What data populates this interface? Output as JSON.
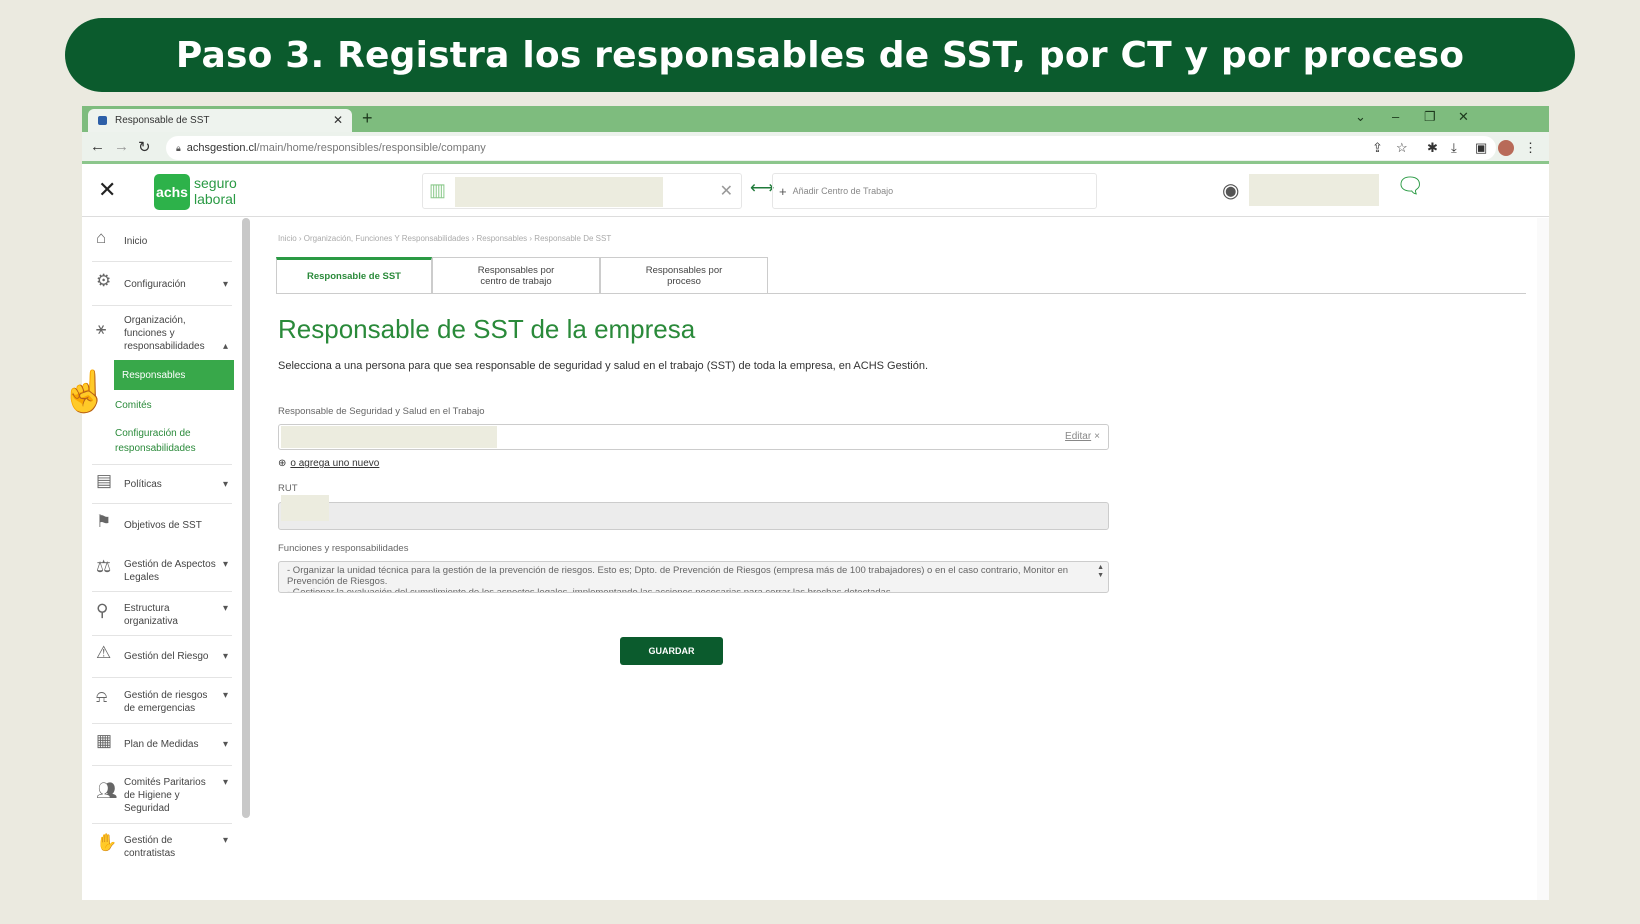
{
  "banner": {
    "title": "Paso 3. Registra los responsables de SST, por CT y por proceso"
  },
  "browser": {
    "tab_title": "Responsable de SST",
    "new_tab": "+",
    "url_host": "achsgestion.cl",
    "url_path": "/main/home/responsibles/responsible/company",
    "controls": {
      "minimize": "–",
      "restore": "❐",
      "close": "✕",
      "tabs_menu": "⌄",
      "tab_close": "✕"
    }
  },
  "app_header": {
    "close": "✕",
    "logo_mark": "achs",
    "logo_line1": "seguro",
    "logo_line2": "laboral",
    "swap_icon": "⟷",
    "add_ct_placeholder": "Añadir Centro de Trabajo"
  },
  "sidebar": {
    "items": [
      {
        "label": "Inicio",
        "icon": "home-icon"
      },
      {
        "label": "Configuración",
        "icon": "gear-icon"
      },
      {
        "label": "Organización, funciones y responsabilidades",
        "icon": "network-icon"
      },
      {
        "label": "Políticas",
        "icon": "document-icon"
      },
      {
        "label": "Objetivos de SST",
        "icon": "chart-flag-icon"
      },
      {
        "label": "Gestión de Aspectos Legales",
        "icon": "scales-icon"
      },
      {
        "label": "Estructura organizativa",
        "icon": "org-chart-icon"
      },
      {
        "label": "Gestión del Riesgo",
        "icon": "warning-icon"
      },
      {
        "label": "Gestión de riesgos de emergencias",
        "icon": "siren-icon"
      },
      {
        "label": "Plan de Medidas",
        "icon": "clipboard-icon"
      },
      {
        "label": "Comités Paritarios de Higiene y Seguridad",
        "icon": "group-icon"
      },
      {
        "label": "Gestión de contratistas",
        "icon": "handshake-icon"
      }
    ],
    "sub_items": [
      "Responsables",
      "Comités",
      "Configuración de responsabilidades"
    ]
  },
  "main": {
    "breadcrumb": "Inicio › Organización, Funciones Y Responsabilidades › Responsables › Responsable De SST",
    "tabs": [
      "Responsable de SST",
      "Responsables por centro de trabajo",
      "Responsables por proceso"
    ],
    "title": "Responsable de SST de la empresa",
    "description": "Selecciona a una persona para que sea responsable de seguridad y salud en el trabajo (SST) de toda la empresa, en ACHS Gestión.",
    "responsible_label": "Responsable de Seguridad y Salud en el Trabajo",
    "edit_label": "Editar",
    "edit_clear": "×",
    "add_new_label": "o agrega uno nuevo",
    "rut_label": "RUT",
    "functions_label": "Funciones y responsabilidades",
    "functions_text": "- Organizar la unidad técnica para la gestión de la prevención de riesgos. Esto es; Dpto. de Prevención de Riesgos (empresa más de 100 trabajadores) o en el caso contrario, Monitor en Prevención de Riesgos.\n- Gestionar la evaluación del cumplimiento de los aspectos legales, implementando las acciones necesarias para cerrar las brechas detectadas.",
    "save_button": "GUARDAR"
  },
  "colors": {
    "brand_dark": "#0b5b2d",
    "brand": "#2a9a44",
    "active_nav": "#38a84a",
    "browser_frame": "#7ebc7e"
  }
}
